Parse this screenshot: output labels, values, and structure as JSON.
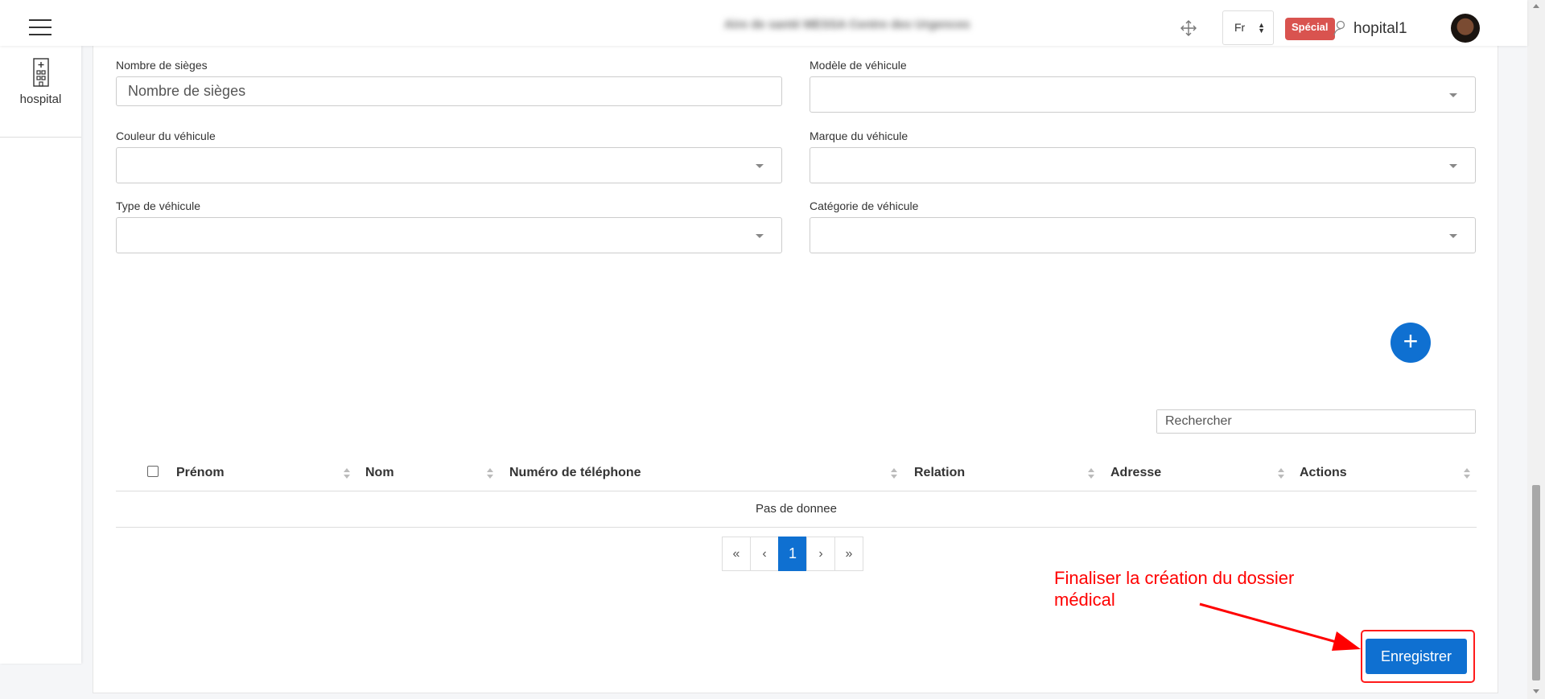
{
  "header": {
    "hospital_name": "Aire de santé MESSA Centre des Urgences",
    "language": "Fr",
    "special_badge": "Spécial",
    "username": "hopital1"
  },
  "sidebar": {
    "items": [
      {
        "label": "hospital",
        "icon": "hospital-building-icon"
      }
    ]
  },
  "form": {
    "seats_label": "Nombre de sièges",
    "seats_placeholder": "Nombre de sièges",
    "model_label": "Modèle de véhicule",
    "color_label": "Couleur du véhicule",
    "brand_label": "Marque du véhicule",
    "type_label": "Type de véhicule",
    "category_label": "Catégorie de véhicule"
  },
  "add_button": "+",
  "search": {
    "placeholder": "Rechercher"
  },
  "table": {
    "columns": [
      "Prénom",
      "Nom",
      "Numéro de téléphone",
      "Relation",
      "Adresse",
      "Actions"
    ],
    "empty_text": "Pas de donnee"
  },
  "pagination": {
    "first": "«",
    "prev": "‹",
    "current": "1",
    "next": "›",
    "last": "»"
  },
  "annotation": {
    "text": "Finaliser la création du dossier médical",
    "color": "#ff0000"
  },
  "save_button": "Enregistrer",
  "colors": {
    "primary": "#0f70d1",
    "badge": "#d9534f"
  }
}
